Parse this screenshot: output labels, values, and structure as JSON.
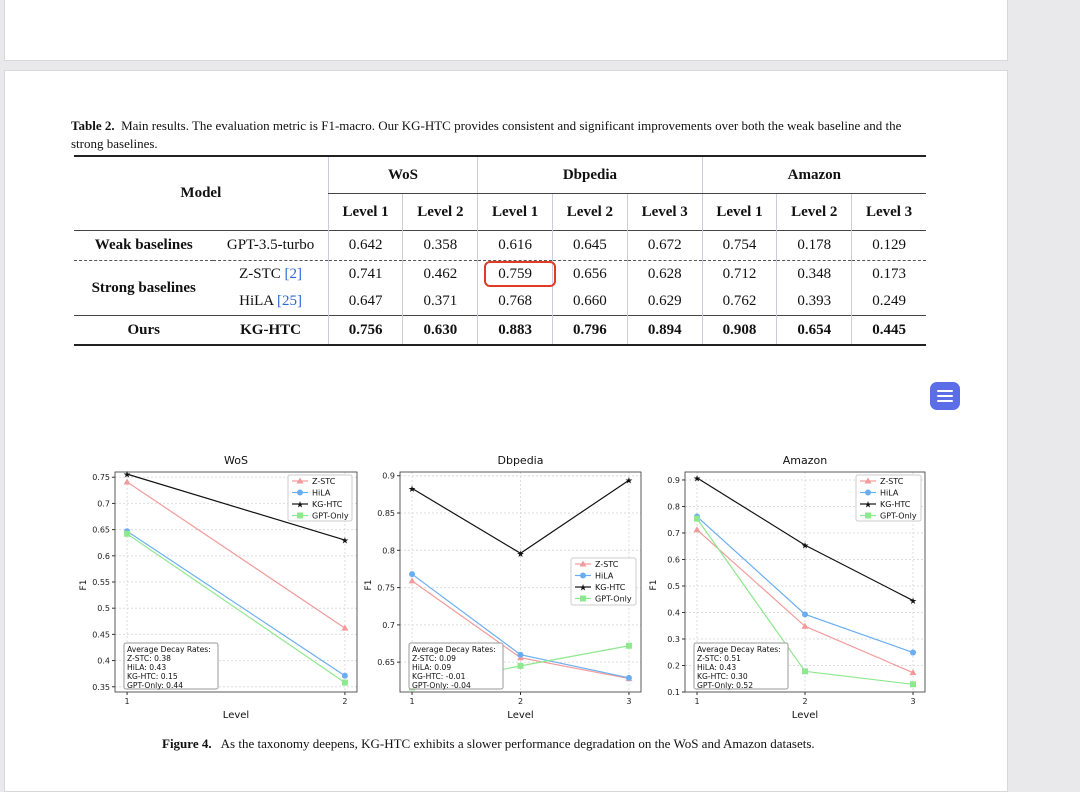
{
  "caption": {
    "label": "Table 2.",
    "text": "Main results. The evaluation metric is F1-macro. Our KG-HTC provides consistent and significant improvements over both the weak baseline and the strong baselines."
  },
  "table": {
    "model_header": "Model",
    "groups": [
      "WoS",
      "Dbpedia",
      "Amazon"
    ],
    "levels": [
      "Level 1",
      "Level 2",
      "Level 1",
      "Level 2",
      "Level 3",
      "Level 1",
      "Level 2",
      "Level 3"
    ],
    "rows": [
      {
        "group": "Weak baselines",
        "model": "GPT-3.5-turbo",
        "cite": "",
        "values": [
          "0.642",
          "0.358",
          "0.616",
          "0.645",
          "0.672",
          "0.754",
          "0.178",
          "0.129"
        ]
      },
      {
        "group": "Strong baselines",
        "model": "Z-STC",
        "cite": "[2]",
        "values": [
          "0.741",
          "0.462",
          "0.759",
          "0.656",
          "0.628",
          "0.712",
          "0.348",
          "0.173"
        ]
      },
      {
        "group": "",
        "model": "HiLA",
        "cite": "[25]",
        "values": [
          "0.647",
          "0.371",
          "0.768",
          "0.660",
          "0.629",
          "0.762",
          "0.393",
          "0.249"
        ]
      },
      {
        "group": "Ours",
        "model": "KG-HTC",
        "cite": "",
        "values": [
          "0.756",
          "0.630",
          "0.883",
          "0.796",
          "0.894",
          "0.908",
          "0.654",
          "0.445"
        ]
      }
    ]
  },
  "figure_caption": {
    "label": "Figure 4.",
    "text": "As the taxonomy deepens, KG-HTC exhibits a slower performance degradation on the WoS and Amazon datasets."
  },
  "colors": {
    "zstc": "#f29a9a",
    "hila": "#6aaef2",
    "kghtc": "#111111",
    "gpt": "#8ee88e",
    "highlight": "#e03b24",
    "chat": "#5b6ee8"
  },
  "chart_data": [
    {
      "type": "line",
      "title": "WoS",
      "xlabel": "Level",
      "ylabel": "F1",
      "x": [
        1,
        2
      ],
      "ylim": [
        0.34,
        0.76
      ],
      "yticks": [
        0.35,
        0.4,
        0.45,
        0.5,
        0.55,
        0.6,
        0.65,
        0.7,
        0.75
      ],
      "series": [
        {
          "name": "Z-STC",
          "values": [
            0.741,
            0.462
          ]
        },
        {
          "name": "HiLA",
          "values": [
            0.647,
            0.371
          ]
        },
        {
          "name": "KG-HTC",
          "values": [
            0.756,
            0.63
          ]
        },
        {
          "name": "GPT-Only",
          "values": [
            0.642,
            0.358
          ]
        }
      ],
      "decay": [
        "Average Decay Rates:",
        "Z-STC: 0.38",
        "HiLA: 0.43",
        "KG-HTC: 0.15",
        "GPT-Only: 0.44"
      ],
      "legend": "top-right",
      "grid": true
    },
    {
      "type": "line",
      "title": "Dbpedia",
      "xlabel": "Level",
      "ylabel": "F1",
      "x": [
        1,
        2,
        3
      ],
      "ylim": [
        0.61,
        0.905
      ],
      "yticks": [
        0.65,
        0.7,
        0.75,
        0.8,
        0.85,
        0.9
      ],
      "series": [
        {
          "name": "Z-STC",
          "values": [
            0.759,
            0.656,
            0.628
          ]
        },
        {
          "name": "HiLA",
          "values": [
            0.768,
            0.66,
            0.629
          ]
        },
        {
          "name": "KG-HTC",
          "values": [
            0.883,
            0.796,
            0.894
          ]
        },
        {
          "name": "GPT-Only",
          "values": [
            0.616,
            0.645,
            0.672
          ]
        }
      ],
      "decay": [
        "Average Decay Rates:",
        "Z-STC: 0.09",
        "HiLA: 0.09",
        "KG-HTC: -0.01",
        "GPT-Only: -0.04"
      ],
      "legend": "center-right",
      "grid": true
    },
    {
      "type": "line",
      "title": "Amazon",
      "xlabel": "Level",
      "ylabel": "F1",
      "x": [
        1,
        2,
        3
      ],
      "ylim": [
        0.1,
        0.93
      ],
      "yticks": [
        0.1,
        0.2,
        0.3,
        0.4,
        0.5,
        0.6,
        0.7,
        0.8,
        0.9
      ],
      "series": [
        {
          "name": "Z-STC",
          "values": [
            0.712,
            0.348,
            0.173
          ]
        },
        {
          "name": "HiLA",
          "values": [
            0.762,
            0.393,
            0.249
          ]
        },
        {
          "name": "KG-HTC",
          "values": [
            0.908,
            0.654,
            0.445
          ]
        },
        {
          "name": "GPT-Only",
          "values": [
            0.754,
            0.178,
            0.129
          ]
        }
      ],
      "decay": [
        "Average Decay Rates:",
        "Z-STC: 0.51",
        "HiLA: 0.43",
        "KG-HTC: 0.30",
        "GPT-Only: 0.52"
      ],
      "legend": "top-right",
      "grid": true
    }
  ]
}
